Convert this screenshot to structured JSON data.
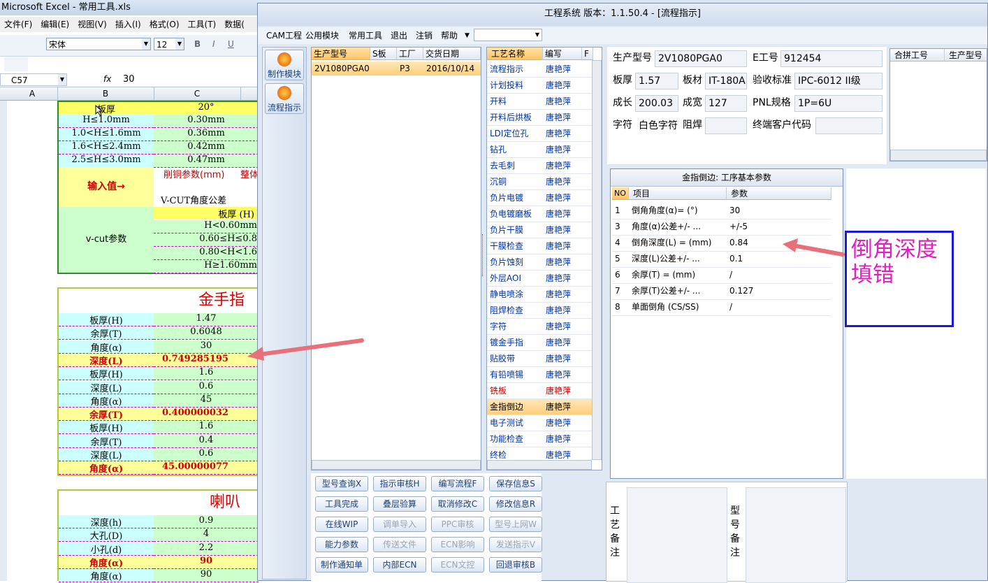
{
  "excel": {
    "title": "Microsoft Excel - 常用工具.xls",
    "menu": [
      "文件(F)",
      "编辑(E)",
      "视图(V)",
      "插入(I)",
      "格式(O)",
      "工具(T)",
      "数据("
    ],
    "font_name": "宋体",
    "font_size": "12",
    "bold": "B",
    "italic": "I",
    "underline": "U",
    "name_box": "C57",
    "fx": "fx",
    "formula": "30",
    "col_headers": [
      "A",
      "B",
      "C"
    ],
    "table1": {
      "header": [
        "板厚",
        "20°"
      ],
      "rows": [
        [
          "H≤1.0mm",
          "0.30mm"
        ],
        [
          "1.0<H≤1.6mm",
          "0.36mm"
        ],
        [
          "1.6<H≤2.4mm",
          "0.42mm"
        ],
        [
          "2.5≤H≤3.0mm",
          "0.47mm"
        ]
      ],
      "input_label": "输入值→",
      "copper_label": "削铜参数(mm)",
      "whole_label": "整体",
      "vcut_tol": "V-CUT角度公差",
      "vcut_label": "v-cut参数",
      "thick_h": "板厚 (H)",
      "vcut_rows": [
        "H<0.60mm",
        "0.60≤H≤0.8",
        "0.80<H<1.6",
        "H≥1.60mm"
      ]
    },
    "table2": {
      "title": "金手指",
      "rows": [
        {
          "k": "板厚(H)",
          "v": "1.47",
          "hl": false
        },
        {
          "k": "余厚(T)",
          "v": "0.6048",
          "hl": false
        },
        {
          "k": "角度(α)",
          "v": "30",
          "hl": false
        },
        {
          "k": "深度(L)",
          "v": "0.749285195",
          "hl": true
        },
        {
          "k": "板厚(H)",
          "v": "1.6",
          "hl": false
        },
        {
          "k": "深度(L)",
          "v": "0.6",
          "hl": false
        },
        {
          "k": "角度(α)",
          "v": "45",
          "hl": false
        },
        {
          "k": "余厚(T)",
          "v": "0.400000032",
          "hl": true
        },
        {
          "k": "板厚(H)",
          "v": "1.6",
          "hl": false
        },
        {
          "k": "余厚(T)",
          "v": "0.4",
          "hl": false
        },
        {
          "k": "深度(L)",
          "v": "0.6",
          "hl": false
        },
        {
          "k": "角度(α)",
          "v": "45.00000077",
          "hl": true
        }
      ]
    },
    "table3": {
      "title": "喇叭",
      "rows": [
        {
          "k": "深度(h)",
          "v": "0.9",
          "hl": false
        },
        {
          "k": "大孔(D)",
          "v": "4",
          "hl": false
        },
        {
          "k": "小孔(d)",
          "v": "2.2",
          "hl": false
        },
        {
          "k": "角度(α)",
          "v": "90",
          "hl": true
        },
        {
          "k": "角度(α)",
          "v": "90",
          "hl": false
        }
      ]
    }
  },
  "app": {
    "title": "工程系统  版本：1.1.50.4 - [流程指示]",
    "menu": [
      "CAM工程",
      "公用模块",
      "常用工具",
      "退出",
      "注销",
      "帮助"
    ],
    "left_buttons": [
      "制作模块",
      "流程指示"
    ],
    "order_grid": {
      "headers": [
        "生产型号",
        "S板",
        "工厂",
        "交货日期"
      ],
      "rows": [
        [
          "2V1080PGA0",
          "",
          "P3",
          "2016/10/14"
        ]
      ]
    },
    "process_grid": {
      "headers": [
        "工艺名称",
        "编写",
        "F"
      ],
      "rows": [
        {
          "name": "流程指示",
          "writer": "唐艳萍",
          "s": "normal"
        },
        {
          "name": "计划投料",
          "writer": "唐艳萍",
          "s": "normal"
        },
        {
          "name": "开料",
          "writer": "唐艳萍",
          "s": "normal"
        },
        {
          "name": "开料后烘板",
          "writer": "唐艳萍",
          "s": "normal"
        },
        {
          "name": "LDI定位孔",
          "writer": "唐艳萍",
          "s": "normal"
        },
        {
          "name": "钻孔",
          "writer": "唐艳萍",
          "s": "normal"
        },
        {
          "name": "去毛刺",
          "writer": "唐艳萍",
          "s": "normal"
        },
        {
          "name": "沉铜",
          "writer": "唐艳萍",
          "s": "normal"
        },
        {
          "name": "负片电镀",
          "writer": "唐艳萍",
          "s": "normal"
        },
        {
          "name": "负电镀磨板",
          "writer": "唐艳萍",
          "s": "normal"
        },
        {
          "name": "负片干膜",
          "writer": "唐艳萍",
          "s": "normal"
        },
        {
          "name": "干膜检查",
          "writer": "唐艳萍",
          "s": "normal"
        },
        {
          "name": "负片蚀刻",
          "writer": "唐艳萍",
          "s": "normal"
        },
        {
          "name": "外层AOI",
          "writer": "唐艳萍",
          "s": "normal"
        },
        {
          "name": "静电喷涂",
          "writer": "唐艳萍",
          "s": "normal"
        },
        {
          "name": "阻焊检查",
          "writer": "唐艳萍",
          "s": "normal"
        },
        {
          "name": "字符",
          "writer": "唐艳萍",
          "s": "normal"
        },
        {
          "name": "镀金手指",
          "writer": "唐艳萍",
          "s": "normal"
        },
        {
          "name": "贴胶带",
          "writer": "唐艳萍",
          "s": "normal"
        },
        {
          "name": "有铅喷锡",
          "writer": "唐艳萍",
          "s": "normal"
        },
        {
          "name": "铣板",
          "writer": "唐艳萍",
          "s": "red"
        },
        {
          "name": "金指倒边",
          "writer": "唐艳萍",
          "s": "selected"
        },
        {
          "name": "电子测试",
          "writer": "唐艳萍",
          "s": "normal"
        },
        {
          "name": "功能检查",
          "writer": "唐艳萍",
          "s": "normal"
        },
        {
          "name": "终检",
          "writer": "唐艳萍",
          "s": "normal"
        }
      ]
    },
    "buttons": [
      [
        "型号查询X",
        "指示审核H",
        "编写流程F",
        "保存信息S"
      ],
      [
        "工具完成",
        "叠层验算",
        "取消修改C",
        "修改信息R"
      ],
      [
        "在线WIP",
        "调单导入",
        "PPC审核",
        "型号上网W"
      ],
      [
        "能力参数",
        "传送文件",
        "ECN影响",
        "发送指示V"
      ],
      [
        "制作通知单",
        "内部ECN",
        "ECN文控",
        "回退审核B"
      ]
    ],
    "disabled_buttons": [
      "调单导入",
      "PPC审核",
      "型号上网W",
      "传送文件",
      "ECN影响",
      "发送指示V",
      "ECN文控"
    ],
    "info": {
      "prod_model_label": "生产型号",
      "prod_model": "2V1080PGA0",
      "e_no_label": "E工号",
      "e_no": "912454",
      "thick_label": "板厚",
      "thick": "1.57",
      "material_label": "板材",
      "material": "IT-180A",
      "accept_label": "验收标准",
      "accept": "IPC-6012 II级",
      "length_label": "成长",
      "length": "200.03",
      "width_label": "成宽",
      "width": "127",
      "pnl_label": "PNL规格",
      "pnl": "1P=6U",
      "char_label": "字符",
      "char": "白色字符",
      "mask_label": "阻焊",
      "mask": "",
      "cust_label": "终端客户代码",
      "cust": ""
    },
    "merge_grid": {
      "headers": [
        "合拼工号",
        "生产型号"
      ]
    },
    "params": {
      "title": "金指倒边: 工序基本参数",
      "headers": [
        "NO",
        "项目",
        "参数"
      ],
      "rows": [
        [
          "1",
          "倒角角度(α)= (°)",
          "30"
        ],
        [
          "3",
          "角度(α)公差+/- ...",
          "+/-5"
        ],
        [
          "4",
          "倒角深度(L) = (mm)",
          "0.84"
        ],
        [
          "5",
          "深度(L)公差+/- ...",
          "0.1"
        ],
        [
          "6",
          "余厚(T) = (mm)",
          "/"
        ],
        [
          "7",
          "余厚(T)公差+/- ...",
          "0.127"
        ],
        [
          "8",
          "单面倒角 (CS/SS)",
          "/"
        ]
      ]
    },
    "remark_process": "工艺备注",
    "remark_model": "型号备注"
  },
  "annotation": {
    "line1": "倒角深度",
    "line2": "填错",
    "arrow_color": "#e8707a",
    "box_color": "#1a1ad8",
    "text_color": "#e020c0"
  }
}
